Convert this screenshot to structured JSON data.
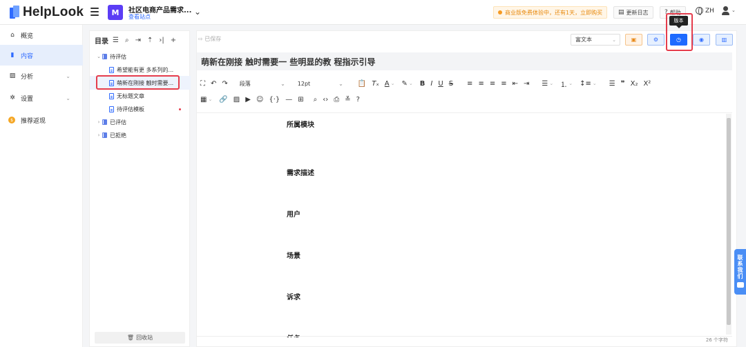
{
  "app": {
    "name": "HelpLook"
  },
  "header": {
    "site_name": "社区电商产品需求...",
    "site_link": "查看站点",
    "trial_notice": "商业版免费体验中，还有1天，立即购买",
    "changelog": "更新日志",
    "help": "帮助",
    "language": "ZH"
  },
  "sidebar": {
    "items": [
      {
        "label": "概览",
        "icon": "home-icon"
      },
      {
        "label": "内容",
        "icon": "content-icon"
      },
      {
        "label": "分析",
        "icon": "chart-icon"
      },
      {
        "label": "设置",
        "icon": "gear-icon"
      },
      {
        "label": "推荐返现",
        "icon": "coin-icon"
      }
    ]
  },
  "tree": {
    "title": "目录",
    "items": [
      {
        "label": "待评估",
        "type": "folder",
        "expanded": true
      },
      {
        "label": "希望能有更 多系列的...",
        "type": "doc"
      },
      {
        "label": "萌新在刚接 触时需要...",
        "type": "doc",
        "selected": true
      },
      {
        "label": "无标题文章",
        "type": "doc"
      },
      {
        "label": "待评估模板",
        "type": "doc"
      },
      {
        "label": "已评估",
        "type": "folder",
        "expanded": false
      },
      {
        "label": "已拒绝",
        "type": "folder",
        "expanded": false
      }
    ],
    "recycle_bin": "回收站"
  },
  "editor": {
    "saved_status": "已保存",
    "editor_type": "富文本",
    "tooltip": "版本",
    "title": "萌新在刚接 触时需要一 些明显的教 程指示引导",
    "block_format": "段落",
    "font_size": "12pt",
    "headings": [
      "所属模块",
      "需求描述",
      "用户",
      "场景",
      "诉求",
      "任务"
    ],
    "word_count": "26 个字符"
  },
  "contact": {
    "label": "联系我们"
  },
  "colors": {
    "accent": "#2f6bff",
    "highlight": "#e53c4c",
    "warning": "#e8890c"
  }
}
